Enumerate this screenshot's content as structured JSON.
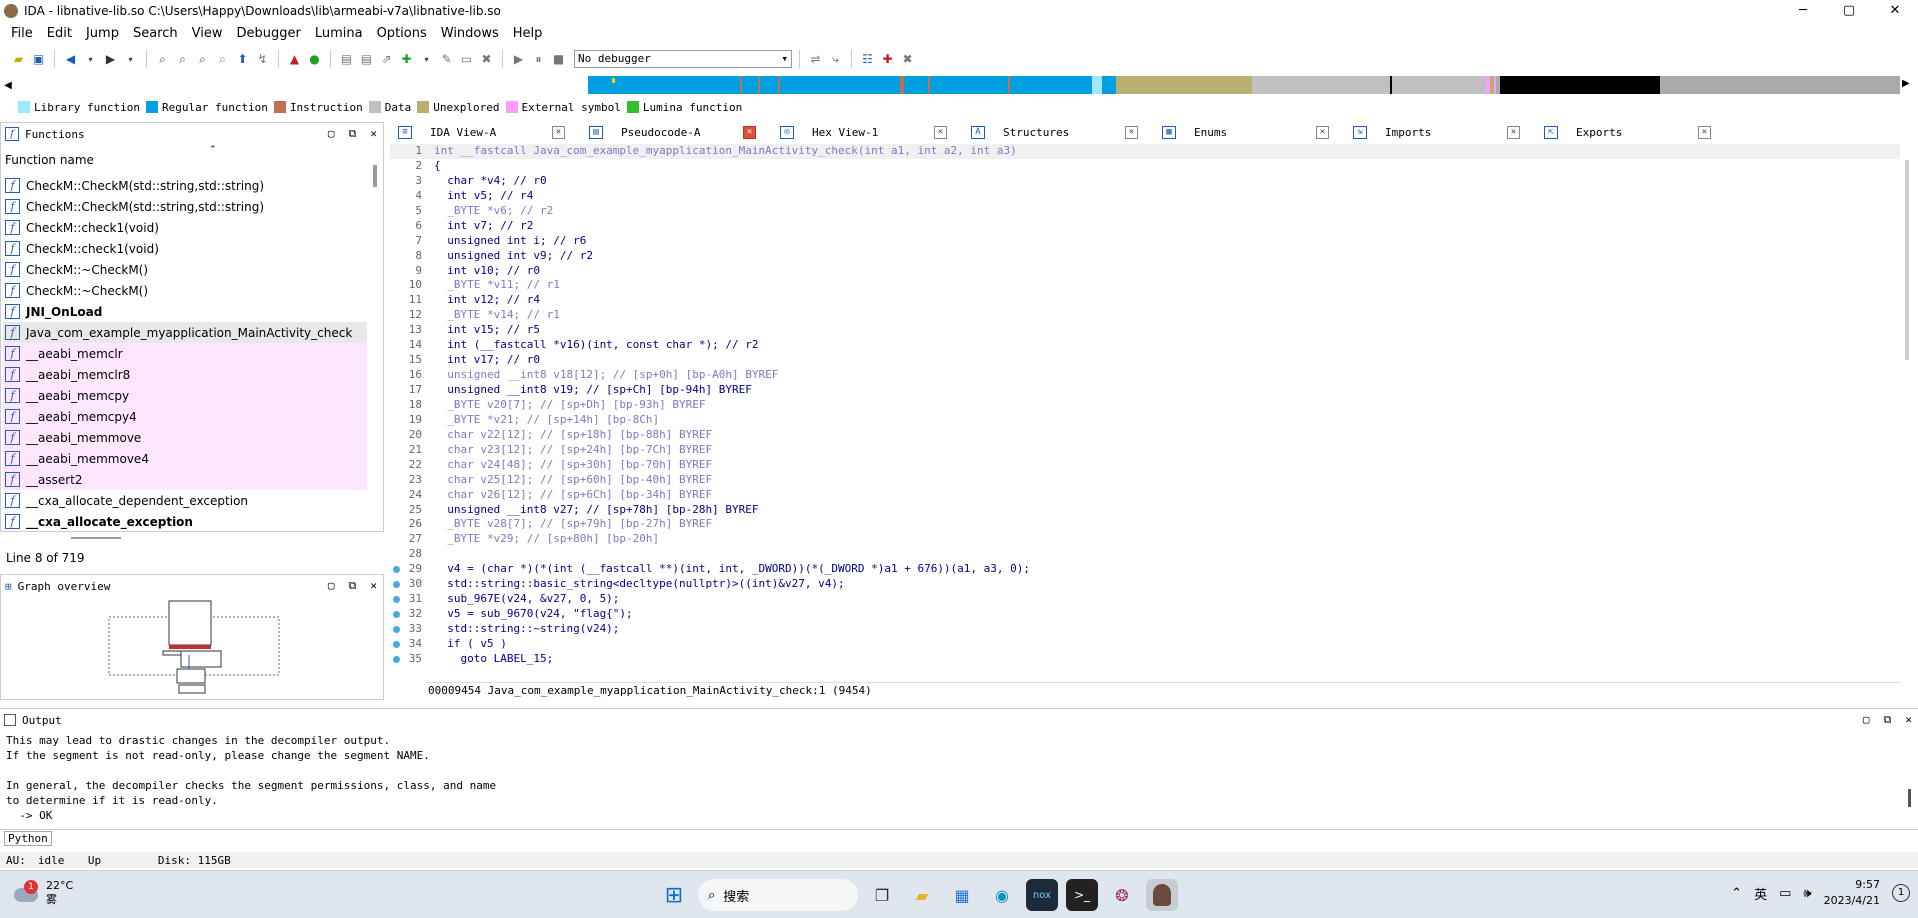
{
  "window": {
    "title": "IDA - libnative-lib.so C:\\Users\\Happy\\Downloads\\lib\\armeabi-v7a\\libnative-lib.so",
    "minimize": "─",
    "maximize": "▢",
    "close": "✕"
  },
  "menu": [
    "File",
    "Edit",
    "Jump",
    "Search",
    "View",
    "Debugger",
    "Lumina",
    "Options",
    "Windows",
    "Help"
  ],
  "toolbar": {
    "debugger": "No debugger"
  },
  "legend": [
    {
      "label": "Library function",
      "color": "#a0e8ff"
    },
    {
      "label": "Regular function",
      "color": "#00a0e0"
    },
    {
      "label": "Instruction",
      "color": "#c07050"
    },
    {
      "label": "Data",
      "color": "#c0c0c0"
    },
    {
      "label": "Unexplored",
      "color": "#b8b070"
    },
    {
      "label": "External symbol",
      "color": "#ff9cff"
    },
    {
      "label": "Lumina function",
      "color": "#30c030"
    }
  ],
  "functions": {
    "title": "Functions",
    "column": "Function name",
    "items": [
      {
        "name": "CheckM::CheckM(std::string,std::string)",
        "style": "normal"
      },
      {
        "name": "CheckM::CheckM(std::string,std::string)",
        "style": "normal"
      },
      {
        "name": "CheckM::check1(void)",
        "style": "normal"
      },
      {
        "name": "CheckM::check1(void)",
        "style": "normal"
      },
      {
        "name": "CheckM::~CheckM()",
        "style": "normal"
      },
      {
        "name": "CheckM::~CheckM()",
        "style": "normal"
      },
      {
        "name": "JNI_OnLoad",
        "style": "bold"
      },
      {
        "name": "Java_com_example_myapplication_MainActivity_check",
        "style": "sel"
      },
      {
        "name": "__aeabi_memclr",
        "style": "lib"
      },
      {
        "name": "__aeabi_memclr8",
        "style": "lib"
      },
      {
        "name": "__aeabi_memcpy",
        "style": "lib"
      },
      {
        "name": "__aeabi_memcpy4",
        "style": "lib"
      },
      {
        "name": "__aeabi_memmove",
        "style": "lib"
      },
      {
        "name": "__aeabi_memmove4",
        "style": "lib"
      },
      {
        "name": "__assert2",
        "style": "lib"
      },
      {
        "name": "__cxa_allocate_dependent_exception",
        "style": "normal"
      },
      {
        "name": "__cxa_allocate_exception",
        "style": "bold"
      }
    ],
    "status": "Line 8 of 719"
  },
  "graph": {
    "title": "Graph overview"
  },
  "tabs": [
    {
      "label": "IDA View-A",
      "icon": "≡",
      "active": false
    },
    {
      "label": "Pseudocode-A",
      "icon": "▤",
      "active": true
    },
    {
      "label": "Hex View-1",
      "icon": "◎",
      "active": false
    },
    {
      "label": "Structures",
      "icon": "A",
      "active": false
    },
    {
      "label": "Enums",
      "icon": "▦",
      "active": false
    },
    {
      "label": "Imports",
      "icon": "⇲",
      "active": false
    },
    {
      "label": "Exports",
      "icon": "⇱",
      "active": false
    }
  ],
  "code": [
    {
      "n": "1",
      "t": "int __fastcall Java_com_example_myapplication_MainActivity_check(int a1, int a2, int a3)",
      "bp": false
    },
    {
      "n": "2",
      "t": "{",
      "bp": false
    },
    {
      "n": "3",
      "t": "  char *v4; // r0",
      "bp": false
    },
    {
      "n": "4",
      "t": "  int v5; // r4",
      "bp": false
    },
    {
      "n": "5",
      "t": "  _BYTE *v6; // r2",
      "bp": false
    },
    {
      "n": "6",
      "t": "  int v7; // r2",
      "bp": false
    },
    {
      "n": "7",
      "t": "  unsigned int i; // r6",
      "bp": false
    },
    {
      "n": "8",
      "t": "  unsigned int v9; // r2",
      "bp": false
    },
    {
      "n": "9",
      "t": "  int v10; // r0",
      "bp": false
    },
    {
      "n": "10",
      "t": "  _BYTE *v11; // r1",
      "bp": false
    },
    {
      "n": "11",
      "t": "  int v12; // r4",
      "bp": false
    },
    {
      "n": "12",
      "t": "  _BYTE *v14; // r1",
      "bp": false
    },
    {
      "n": "13",
      "t": "  int v15; // r5",
      "bp": false
    },
    {
      "n": "14",
      "t": "  int (__fastcall *v16)(int, const char *); // r2",
      "bp": false
    },
    {
      "n": "15",
      "t": "  int v17; // r0",
      "bp": false
    },
    {
      "n": "16",
      "t": "  unsigned __int8 v18[12]; // [sp+0h] [bp-A0h] BYREF",
      "bp": false
    },
    {
      "n": "17",
      "t": "  unsigned __int8 v19; // [sp+Ch] [bp-94h] BYREF",
      "bp": false
    },
    {
      "n": "18",
      "t": "  _BYTE v20[7]; // [sp+Dh] [bp-93h] BYREF",
      "bp": false
    },
    {
      "n": "19",
      "t": "  _BYTE *v21; // [sp+14h] [bp-8Ch]",
      "bp": false
    },
    {
      "n": "20",
      "t": "  char v22[12]; // [sp+18h] [bp-88h] BYREF",
      "bp": false
    },
    {
      "n": "21",
      "t": "  char v23[12]; // [sp+24h] [bp-7Ch] BYREF",
      "bp": false
    },
    {
      "n": "22",
      "t": "  char v24[48]; // [sp+30h] [bp-70h] BYREF",
      "bp": false
    },
    {
      "n": "23",
      "t": "  char v25[12]; // [sp+60h] [bp-40h] BYREF",
      "bp": false
    },
    {
      "n": "24",
      "t": "  char v26[12]; // [sp+6Ch] [bp-34h] BYREF",
      "bp": false
    },
    {
      "n": "25",
      "t": "  unsigned __int8 v27; // [sp+78h] [bp-28h] BYREF",
      "bp": false
    },
    {
      "n": "26",
      "t": "  _BYTE v28[7]; // [sp+79h] [bp-27h] BYREF",
      "bp": false
    },
    {
      "n": "27",
      "t": "  _BYTE *v29; // [sp+80h] [bp-20h]",
      "bp": false
    },
    {
      "n": "28",
      "t": "",
      "bp": false
    },
    {
      "n": "29",
      "t": "  v4 = (char *)(*(int (__fastcall **)(int, int, _DWORD))(*(_DWORD *)a1 + 676))(a1, a3, 0);",
      "bp": true
    },
    {
      "n": "30",
      "t": "  std::string::basic_string<decltype(nullptr)>((int)&v27, v4);",
      "bp": true
    },
    {
      "n": "31",
      "t": "  sub_967E(v24, &v27, 0, 5);",
      "bp": true
    },
    {
      "n": "32",
      "t": "  v5 = sub_9670(v24, \"flag{\");",
      "bp": true
    },
    {
      "n": "33",
      "t": "  std::string::~string(v24);",
      "bp": true
    },
    {
      "n": "34",
      "t": "  if ( v5 )",
      "bp": true
    },
    {
      "n": "35",
      "t": "    goto LABEL_15;",
      "bp": true
    }
  ],
  "code_status": "00009454 Java_com_example_myapplication_MainActivity_check:1 (9454)",
  "output": {
    "title": "Output",
    "text": "This may lead to drastic changes in the decompiler output.\nIf the segment is not read-only, please change the segment NAME.\n\nIn general, the decompiler checks the segment permissions, class, and name\nto determine if it is read-only.\n  -> OK"
  },
  "python_label": "Python",
  "statusbar": {
    "au": "AU:",
    "state": "idle",
    "dir": "Up",
    "disk": "Disk: 115GB"
  },
  "taskbar": {
    "temp": "22°C",
    "weather": "雾",
    "badge": "1",
    "search": "搜索",
    "ime": "英",
    "time": "9:57",
    "date": "2023/4/21",
    "notif": "1"
  }
}
